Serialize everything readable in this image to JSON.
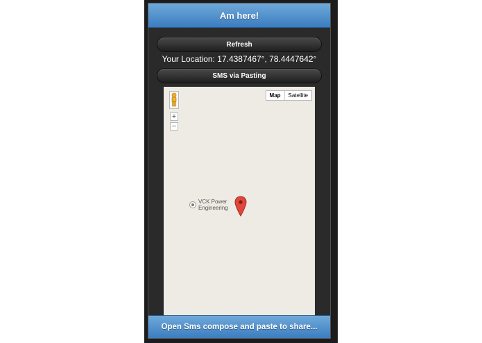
{
  "header": {
    "title": "Am here!"
  },
  "buttons": {
    "refresh_label": "Refresh",
    "sms_label": "SMS via Pasting"
  },
  "location": {
    "text": "Your Location: 17.4387467°, 78.4447642°"
  },
  "map": {
    "type_map": "Map",
    "type_satellite": "Satellite",
    "zoom_in": "+",
    "zoom_out": "−",
    "poi_label_line1": "VCK Power",
    "poi_label_line2": "Engineering",
    "marker_color": "#e0463b",
    "background_color": "#eeebe4"
  },
  "footer": {
    "label": "Open Sms compose and paste to share..."
  },
  "colors": {
    "header_accent": "#4a8ccc",
    "button_dark": "#2a2a2a"
  }
}
